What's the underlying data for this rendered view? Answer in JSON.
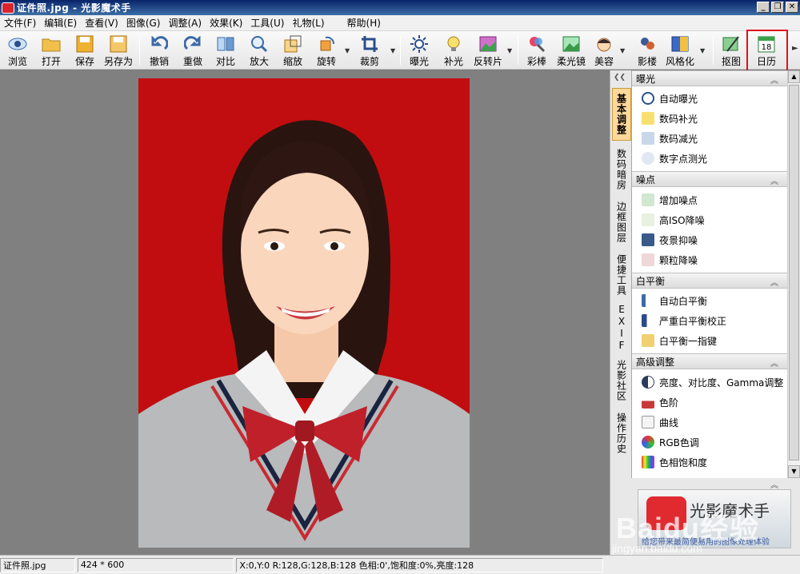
{
  "window": {
    "title": "证件照.jpg - 光影魔术手",
    "minimize": "_",
    "restore": "❐",
    "close": "✕"
  },
  "menu": [
    "文件(F)",
    "编辑(E)",
    "查看(V)",
    "图像(G)",
    "调整(A)",
    "效果(K)",
    "工具(U)",
    "礼物(L)",
    "帮助(H)"
  ],
  "toolbar": {
    "browse": "浏览",
    "open": "打开",
    "save": "保存",
    "save_as": "另存为",
    "undo": "撤销",
    "redo": "重做",
    "compare": "对比",
    "zoom_in": "放大",
    "shrink": "缩放",
    "rotate": "旋转",
    "crop": "裁剪",
    "exposure": "曝光",
    "fill_light": "补光",
    "reversal": "反转片",
    "color_wand": "彩棒",
    "soft_lens": "柔光镜",
    "beauty": "美容",
    "shadow": "影楼",
    "stylize": "风格化",
    "cutout": "抠图",
    "calendar": "日历",
    "calendar_day": "18"
  },
  "side_tabs": [
    "基本调整",
    "数码暗房",
    "边框图层",
    "便捷工具",
    "EXIF",
    "光影社区",
    "操作历史"
  ],
  "panel": {
    "exposure": {
      "title": "曝光",
      "items": [
        "自动曝光",
        "数码补光",
        "数码减光",
        "数字点测光"
      ]
    },
    "noise": {
      "title": "噪点",
      "items": [
        "增加噪点",
        "高ISO降噪",
        "夜景抑噪",
        "颗粒降噪"
      ]
    },
    "white_balance": {
      "title": "白平衡",
      "items": [
        "自动白平衡",
        "严重白平衡校正",
        "白平衡一指键"
      ]
    },
    "advanced": {
      "title": "高级调整",
      "items": [
        "亮度、对比度、Gamma调整",
        "色阶",
        "曲线",
        "RGB色调",
        "色相饱和度"
      ]
    }
  },
  "promo": {
    "title": "光影魔术手",
    "tagline": "给您带来最简便易用的图像处理体验"
  },
  "watermark": {
    "main": "Baidu经验",
    "sub": "jingyan.baidu.com"
  },
  "status": {
    "filename": "证件照.jpg",
    "size": "424 * 600",
    "pixel_info": "X:0,Y:0 R:128,G:128,B:128 色相:0',饱和度:0%,亮度:128"
  }
}
